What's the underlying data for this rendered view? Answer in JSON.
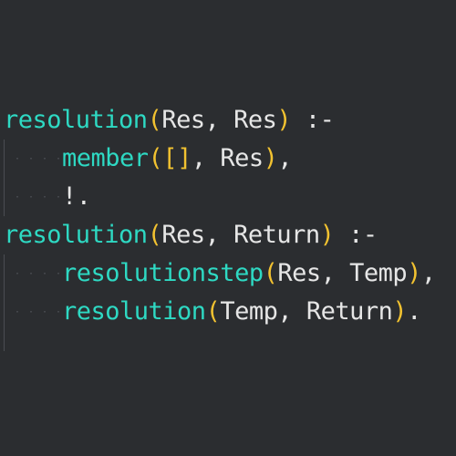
{
  "colors": {
    "background": "#2b2d30",
    "predicate": "#2ed9c3",
    "paren": "#f2c230",
    "text": "#e6e6e6",
    "whitespace_dots": "#55585e"
  },
  "code": {
    "line1": {
      "pred": "resolution",
      "open": "(",
      "args": "Res, Res",
      "close": ")",
      "tail": " :-"
    },
    "line2": {
      "pred": "member",
      "open": "(",
      "list_open": "[",
      "list_close": "]",
      "args": ", Res",
      "close": ")",
      "tail": ","
    },
    "line3": {
      "text": "!."
    },
    "line4": {
      "pred": "resolution",
      "open": "(",
      "args": "Res, Return",
      "close": ")",
      "tail": " :-"
    },
    "line5": {
      "pred": "resolutionstep",
      "open": "(",
      "args": "Res, Temp",
      "close": ")",
      "tail": ","
    },
    "line6": {
      "pred": "resolution",
      "open": "(",
      "args": "Temp, Return",
      "close": ")",
      "tail": "."
    }
  }
}
